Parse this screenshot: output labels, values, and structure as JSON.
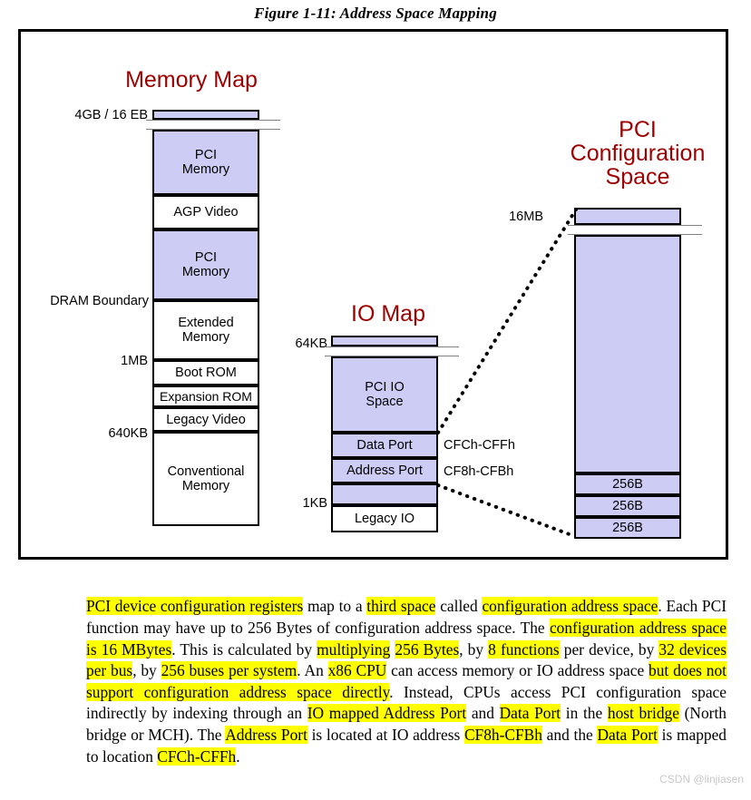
{
  "caption": "Figure 1-11: Address Space Mapping",
  "accent_color": "#9e0000",
  "block_fill_color": "#ccccf5",
  "highlight_color": "#ffff00",
  "memory_map": {
    "title": "Memory Map",
    "top_label": "4GB / 16 EB",
    "blocks": [
      {
        "label": "",
        "fill": "lavender"
      },
      {
        "label": "PCI\nMemory",
        "fill": "lavender"
      },
      {
        "label": "AGP Video",
        "fill": "white"
      },
      {
        "label": "PCI\nMemory",
        "fill": "lavender"
      },
      {
        "label": "Extended\nMemory",
        "fill": "white"
      },
      {
        "label": "Boot ROM",
        "fill": "white"
      },
      {
        "label": "Expansion ROM",
        "fill": "white"
      },
      {
        "label": "Legacy Video",
        "fill": "white"
      },
      {
        "label": "Conventional\nMemory",
        "fill": "white"
      }
    ],
    "boundary_labels": [
      "DRAM Boundary",
      "1MB",
      "640KB"
    ]
  },
  "io_map": {
    "title": "IO Map",
    "top_label": "64KB",
    "bottom_label": "1KB",
    "blocks": [
      {
        "label": "",
        "fill": "lavender"
      },
      {
        "label": "PCI IO\nSpace",
        "fill": "lavender"
      },
      {
        "label": "Data Port",
        "fill": "lavender"
      },
      {
        "label": "Address Port",
        "fill": "lavender"
      },
      {
        "label": "",
        "fill": "lavender"
      },
      {
        "label": "Legacy IO",
        "fill": "white"
      }
    ],
    "port_notes": [
      "CFCh-CFFh",
      "CF8h-CFBh"
    ]
  },
  "config_space": {
    "title": "PCI\nConfiguration\nSpace",
    "top_label": "16MB",
    "blocks": [
      {
        "label": "",
        "fill": "lavender"
      },
      {
        "label": "",
        "fill": "lavender"
      },
      {
        "label": "256B",
        "fill": "lavender"
      },
      {
        "label": "256B",
        "fill": "lavender"
      },
      {
        "label": "256B",
        "fill": "lavender"
      }
    ]
  },
  "paragraph": {
    "segments": [
      {
        "t": "PCI device configuration registers",
        "h": true
      },
      {
        "t": " map to a ",
        "h": false
      },
      {
        "t": "third space",
        "h": true
      },
      {
        "t": " called ",
        "h": false
      },
      {
        "t": "configuration address space",
        "h": true
      },
      {
        "t": ". Each PCI function may have up to 256 Bytes of configuration address space. The ",
        "h": false
      },
      {
        "t": "configuration address space is 16 MBytes",
        "h": true
      },
      {
        "t": ". This is calculated by ",
        "h": false
      },
      {
        "t": "multiplying",
        "h": true
      },
      {
        "t": " ",
        "h": false
      },
      {
        "t": "256 Bytes",
        "h": true
      },
      {
        "t": ", by ",
        "h": false
      },
      {
        "t": "8 functions",
        "h": true
      },
      {
        "t": " per device, by ",
        "h": false
      },
      {
        "t": "32 devices per bus",
        "h": true
      },
      {
        "t": ", by ",
        "h": false
      },
      {
        "t": "256 buses per system",
        "h": true
      },
      {
        "t": ". An ",
        "h": false
      },
      {
        "t": "x86 CPU",
        "h": true
      },
      {
        "t": " can access memory or IO address space ",
        "h": false
      },
      {
        "t": "but does not support configuration address space directly",
        "h": true
      },
      {
        "t": ". Instead, CPUs access PCI configuration space indirectly by indexing through an ",
        "h": false
      },
      {
        "t": "IO mapped Address Port",
        "h": true
      },
      {
        "t": " and ",
        "h": false
      },
      {
        "t": "Data Port",
        "h": true
      },
      {
        "t": " in the ",
        "h": false
      },
      {
        "t": "host bridge",
        "h": true
      },
      {
        "t": " (North bridge or MCH). The ",
        "h": false
      },
      {
        "t": "Address Port",
        "h": true
      },
      {
        "t": " is located at IO address ",
        "h": false
      },
      {
        "t": "CF8h-CFBh",
        "h": true
      },
      {
        "t": " and the ",
        "h": false
      },
      {
        "t": "Data Port",
        "h": true
      },
      {
        "t": " is mapped to location ",
        "h": false
      },
      {
        "t": "CFCh-CFFh",
        "h": true
      },
      {
        "t": ".",
        "h": false
      }
    ]
  },
  "watermark": "CSDN @linjiasen"
}
